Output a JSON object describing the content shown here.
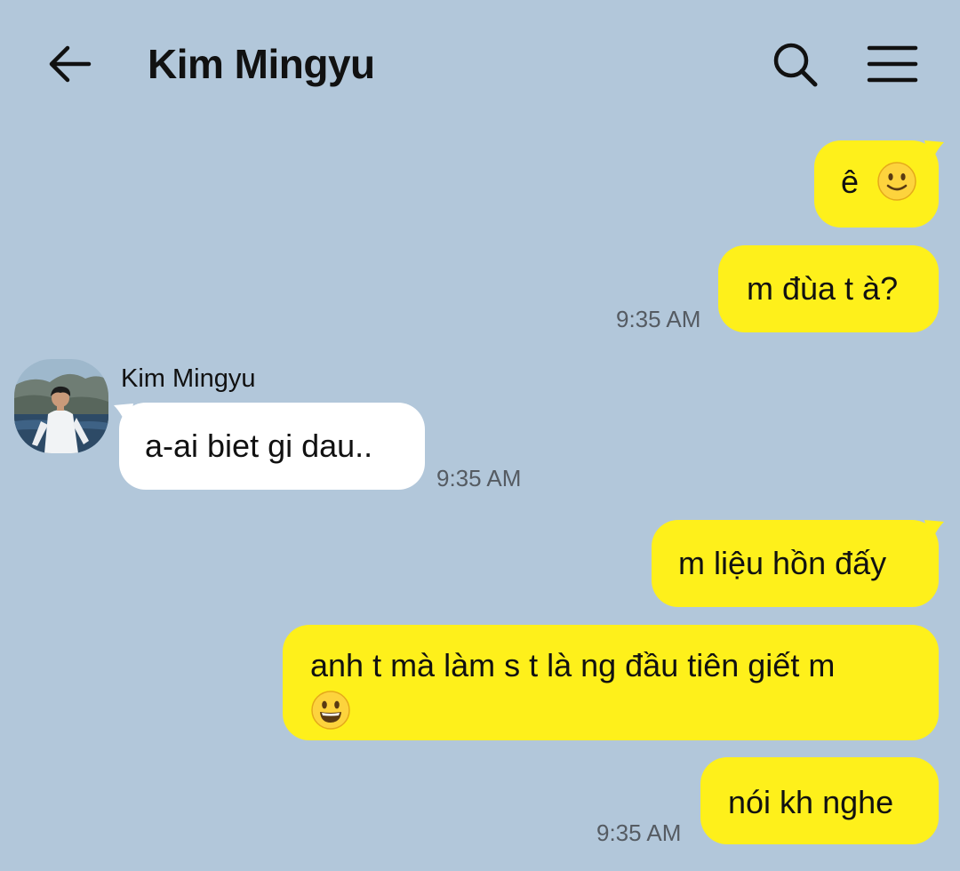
{
  "header": {
    "title": "Kim Mingyu",
    "back_icon": "arrow-left-icon",
    "search_icon": "search-icon",
    "menu_icon": "hamburger-menu-icon"
  },
  "colors": {
    "background": "#b2c7da",
    "my_bubble": "#fef01b",
    "their_bubble": "#ffffff"
  },
  "messages": [
    {
      "from": "me",
      "text": "ê",
      "emoji": "slightly-smiling-face",
      "time": ""
    },
    {
      "from": "me",
      "text": "m đùa t à?",
      "time": "9:35 AM"
    },
    {
      "from": "them",
      "sender": "Kim Mingyu",
      "text": "a-ai biet gi dau..",
      "time": "9:35 AM"
    },
    {
      "from": "me",
      "text": "m liệu hồn đấy",
      "time": ""
    },
    {
      "from": "me",
      "text": "anh t mà làm s t là ng đầu tiên giết m",
      "emoji": "grinning-face",
      "time": ""
    },
    {
      "from": "me",
      "text": "nói kh nghe",
      "time": "9:35 AM"
    }
  ]
}
